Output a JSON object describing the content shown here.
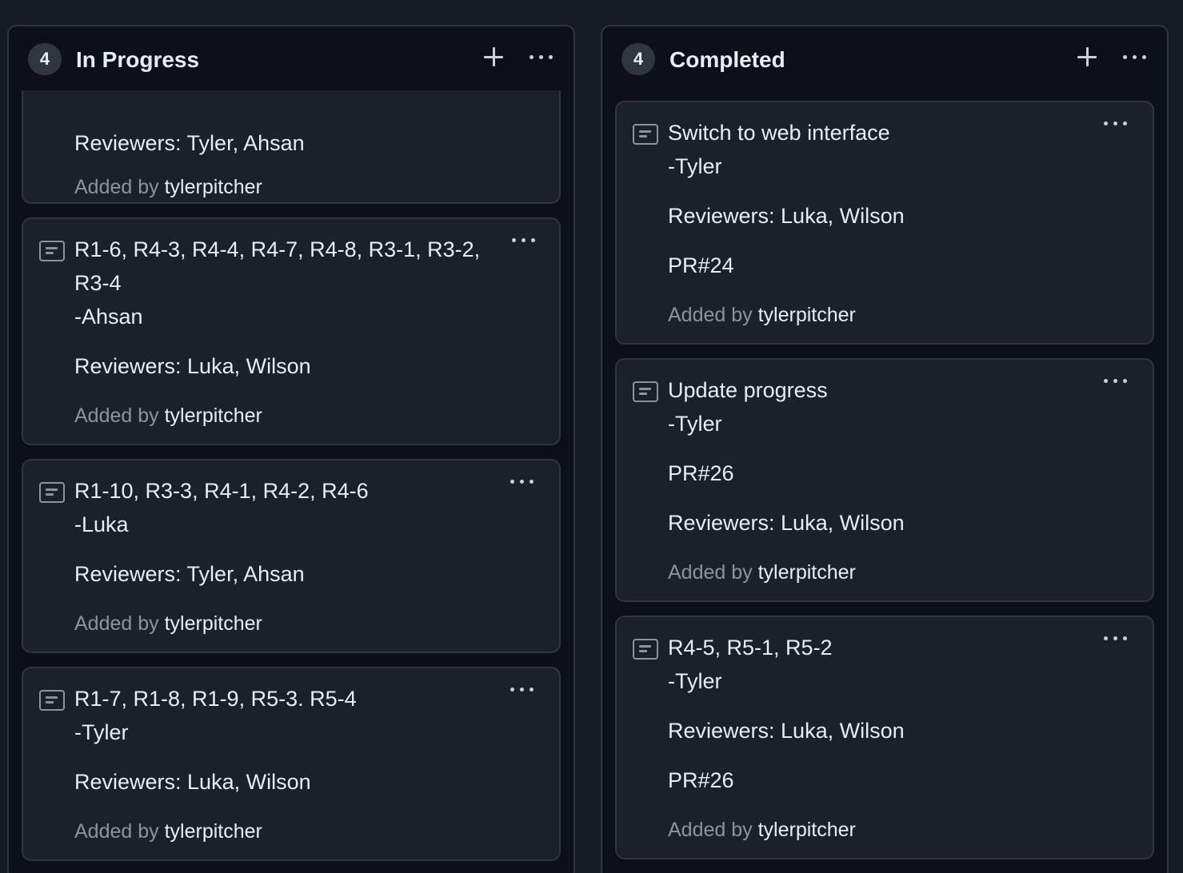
{
  "columns": [
    {
      "count": "4",
      "title": "In Progress",
      "cards": [
        {
          "title_lines": [],
          "author": "",
          "details": [
            "Reviewers: Tyler, Ahsan"
          ],
          "added_prefix": "Added by",
          "added_user": "tylerpitcher"
        },
        {
          "title_lines": [
            "R1-6, R4-3, R4-4, R4-7, R4-8, R3-1, R3-2,",
            "R3-4"
          ],
          "author": "-Ahsan",
          "details": [
            "Reviewers: Luka, Wilson"
          ],
          "added_prefix": "Added by",
          "added_user": "tylerpitcher"
        },
        {
          "title_lines": [
            "R1-10, R3-3, R4-1, R4-2, R4-6"
          ],
          "author": "-Luka",
          "details": [
            "Reviewers: Tyler, Ahsan"
          ],
          "added_prefix": "Added by",
          "added_user": "tylerpitcher"
        },
        {
          "title_lines": [
            "R1-7, R1-8, R1-9, R5-3. R5-4"
          ],
          "author": "-Tyler",
          "details": [
            "Reviewers: Luka, Wilson"
          ],
          "added_prefix": "Added by",
          "added_user": "tylerpitcher"
        }
      ]
    },
    {
      "count": "4",
      "title": "Completed",
      "cards": [
        {
          "title_lines": [
            "Switch to web interface"
          ],
          "author": "-Tyler",
          "details": [
            "Reviewers: Luka, Wilson",
            "PR#24"
          ],
          "added_prefix": "Added by",
          "added_user": "tylerpitcher"
        },
        {
          "title_lines": [
            "Update progress"
          ],
          "author": "-Tyler",
          "details": [
            "PR#26",
            "Reviewers: Luka, Wilson"
          ],
          "added_prefix": "Added by",
          "added_user": "tylerpitcher"
        },
        {
          "title_lines": [
            "R4-5, R5-1, R5-2"
          ],
          "author": "-Tyler",
          "details": [
            "Reviewers: Luka, Wilson",
            "PR#26"
          ],
          "added_prefix": "Added by",
          "added_user": "tylerpitcher"
        }
      ]
    }
  ],
  "icons": {
    "add": "plus-icon",
    "menu": "more-horizontal-icon",
    "card": "note-icon"
  },
  "colors": {
    "background": "#161b22",
    "column": "#0d1117",
    "card": "#1c2128",
    "border": "#30363d",
    "text": "#e6edf3",
    "muted": "#8b949e"
  }
}
